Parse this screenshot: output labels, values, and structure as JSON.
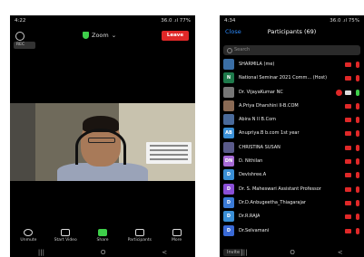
{
  "left": {
    "status_time": "4:22",
    "status_right": "36.0 .ıl 77%",
    "rec_label": "REC",
    "zoom_label": "Zoom",
    "leave_label": "Leave",
    "toolbar": [
      "Unmute",
      "Start Video",
      "Share",
      "Participants",
      "More"
    ],
    "nav": [
      "|||",
      "O",
      "<"
    ]
  },
  "right": {
    "status_time": "4:34",
    "status_right": "36.0 .ıl 75%",
    "close_label": "Close",
    "title": "Participants (69)",
    "search_placeholder": "Search",
    "invite_label": "Invite",
    "participants": [
      {
        "initial": "",
        "color": "#3a6ea5",
        "name": "SHARMILA (me)"
      },
      {
        "initial": "N",
        "color": "#1e7a4b",
        "name": "National Seminar 2021 Comm... (Host)"
      },
      {
        "initial": "",
        "color": "#777777",
        "name": "Dr. VijayaKumar NC"
      },
      {
        "initial": "",
        "color": "#8a6a55",
        "name": "A.Priya Dharshini II-B.COM"
      },
      {
        "initial": "",
        "color": "#4a6a9a",
        "name": "Abira N II B.Com"
      },
      {
        "initial": "AB",
        "color": "#3a8fd6",
        "name": "Anupriya.B b.com 1st year"
      },
      {
        "initial": "",
        "color": "#5a5a8a",
        "name": "CHRISTINA SUSAN"
      },
      {
        "initial": "DN",
        "color": "#a66ad6",
        "name": "D. Nithilan"
      },
      {
        "initial": "D",
        "color": "#3a8fd6",
        "name": "Devishree.A"
      },
      {
        "initial": "D",
        "color": "#8a4fd6",
        "name": "Dr. S. Maheswari Assistant Professor"
      },
      {
        "initial": "D",
        "color": "#3a7ad6",
        "name": "Dr.D.Anbugeetha_Thiagarajar"
      },
      {
        "initial": "D",
        "color": "#3a8fd6",
        "name": "Dr.R.RAJA"
      },
      {
        "initial": "D",
        "color": "#3a6ad6",
        "name": "Dr.Selvamani"
      }
    ],
    "nav": [
      "|||",
      "O",
      "<"
    ]
  }
}
